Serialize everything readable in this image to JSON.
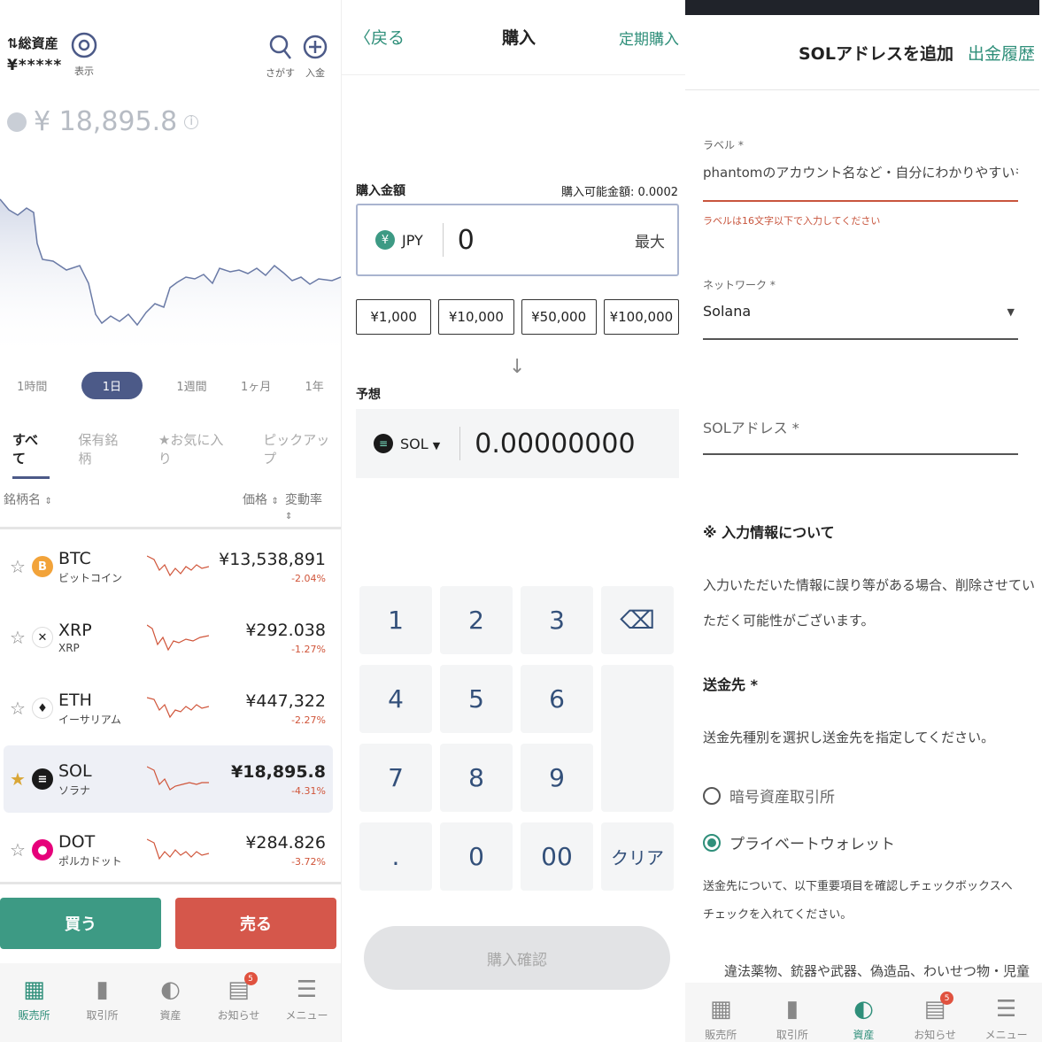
{
  "p1": {
    "total_label": "総資産",
    "total_value": "¥*****",
    "show_label": "表示",
    "search_label": "さがす",
    "deposit_label": "入金",
    "selected_price": "¥ 18,895.8",
    "periods": [
      "1時間",
      "1日",
      "1週間",
      "1ヶ月",
      "1年"
    ],
    "active_period": "1日",
    "filters": [
      "すべて",
      "保有銘柄",
      "★お気に入り",
      "ピックアップ"
    ],
    "col_name": "銘柄名",
    "col_price": "価格",
    "col_change": "変動率",
    "coins": [
      {
        "symbol": "BTC",
        "name_jp": "ビットコイン",
        "price": "¥13,538,891",
        "change": "-2.04%",
        "color": "#f2a33a",
        "glyph": "B"
      },
      {
        "symbol": "XRP",
        "name_jp": "XRP",
        "price": "¥292.038",
        "change": "-1.27%",
        "color": "#ffffff",
        "glyph": "✕"
      },
      {
        "symbol": "ETH",
        "name_jp": "イーサリアム",
        "price": "¥447,322",
        "change": "-2.27%",
        "color": "#ffffff",
        "glyph": "♦"
      },
      {
        "symbol": "SOL",
        "name_jp": "ソラナ",
        "price": "¥18,895.8",
        "change": "-4.31%",
        "color": "#1a1a1a",
        "glyph": "≡"
      },
      {
        "symbol": "DOT",
        "name_jp": "ポルカドット",
        "price": "¥284.826",
        "change": "-3.72%",
        "color": "#e6007a",
        "glyph": "●"
      }
    ],
    "buy_label": "買う",
    "sell_label": "売る"
  },
  "tabs": {
    "items": [
      {
        "label": "販売所",
        "icon": "store-icon"
      },
      {
        "label": "取引所",
        "icon": "bar-chart-icon"
      },
      {
        "label": "資産",
        "icon": "pie-chart-icon"
      },
      {
        "label": "お知らせ",
        "icon": "message-icon"
      },
      {
        "label": "メニュー",
        "icon": "menu-icon"
      }
    ],
    "badge_count": "5"
  },
  "p2": {
    "back_label": "戻る",
    "title": "購入",
    "recurring_label": "定期購入",
    "amount_label": "購入金額",
    "available_label": "購入可能金額: 0.0002",
    "currency": "JPY",
    "amount_value": "0",
    "max_label": "最大",
    "presets": [
      "¥1,000",
      "¥10,000",
      "¥50,000",
      "¥100,000"
    ],
    "estimate_label": "予想",
    "coin": "SOL",
    "estimate_value": "0.00000000",
    "keys": [
      "1",
      "2",
      "3",
      "⌫",
      "4",
      "5",
      "6",
      "",
      "7",
      "8",
      "9",
      "",
      ".",
      "0",
      "00",
      "クリア"
    ],
    "confirm_label": "購入確認"
  },
  "p3": {
    "title": "SOLアドレスを追加",
    "history_label": "出金履歴",
    "label_field_label": "ラベル *",
    "label_field_value": "phantomのアカウント名など・自分にわかりやすいもの",
    "label_error": "ラベルは16文字以下で入力してください",
    "network_label": "ネットワーク *",
    "network_value": "Solana",
    "address_placeholder": "SOLアドレス *",
    "info_heading": "※ 入力情報について",
    "info_text_1": "入力いただいた情報に誤り等がある場合、削除させてい",
    "info_text_2": "ただく可能性がございます。",
    "dest_heading": "送金先 *",
    "dest_text": "送金先種別を選択し送金先を指定してください。",
    "option_exchange": "暗号資産取引所",
    "option_private": "プライベートウォレット",
    "confirm_text_1": "送金先について、以下重要項目を確認しチェックボックスへ",
    "confirm_text_2": "チェックを入れてください。",
    "warning_text": "違法薬物、銃器や武器、偽造品、わいせつ物・児童"
  }
}
